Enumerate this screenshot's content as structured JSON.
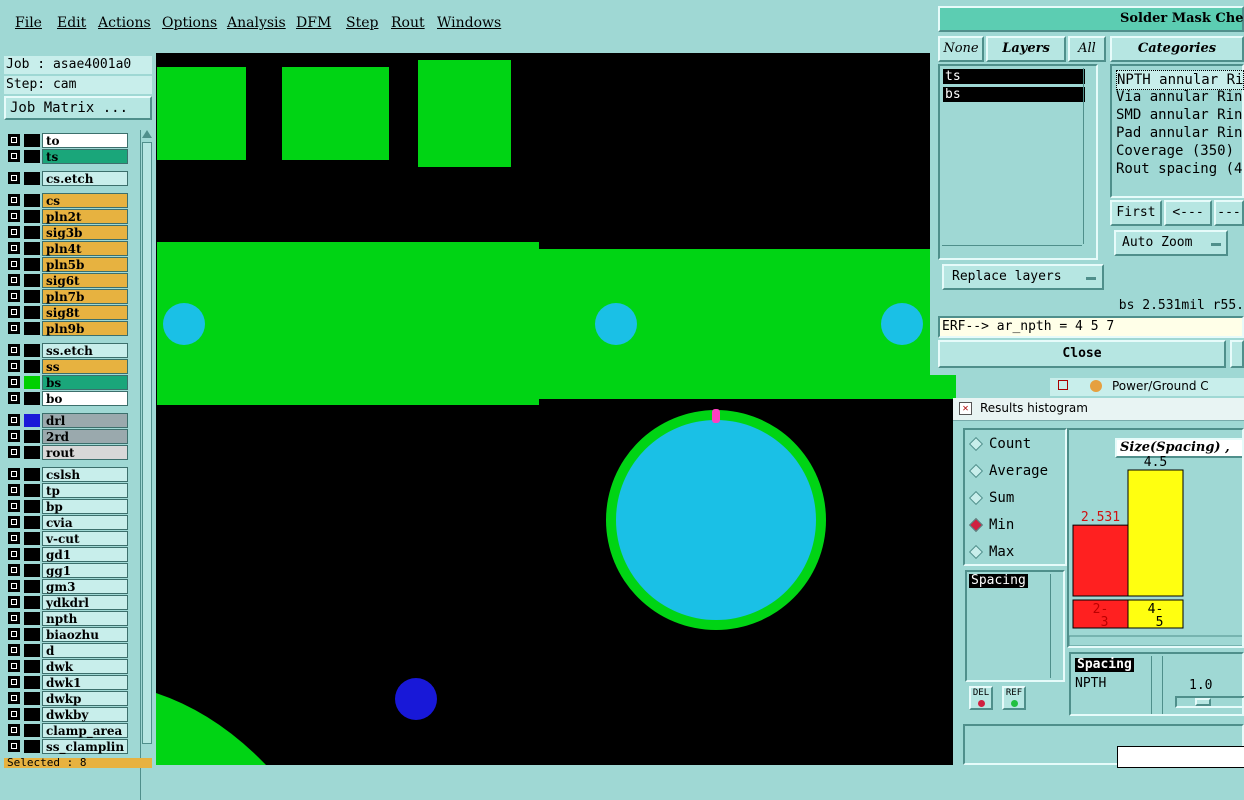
{
  "menubar": {
    "items": [
      "File",
      "Edit",
      "Actions",
      "Options",
      "Analysis",
      "DFM",
      "Step",
      "Rout",
      "Windows"
    ]
  },
  "job": {
    "job_line": "Job : asae4001a0",
    "step_line": "Step: cam",
    "matrix_button": "Job Matrix ...",
    "selected": "Selected : 8"
  },
  "layers": [
    {
      "name": "to",
      "color": "#ffffff",
      "swatch": "#000000",
      "mark": "✐"
    },
    {
      "name": "ts",
      "color": "#1aa67a",
      "swatch": "#000000",
      "mark": "✐"
    },
    {
      "name": "cs.etch",
      "color": "#c8eeeb",
      "swatch": "#000000",
      "mark": ""
    },
    {
      "name": "cs",
      "color": "#e7b240",
      "swatch": "#000000",
      "mark": "✐"
    },
    {
      "name": "pln2t",
      "color": "#e7b240",
      "swatch": "#000000",
      "mark": "✐"
    },
    {
      "name": "sig3b",
      "color": "#e7b240",
      "swatch": "#000000",
      "mark": "✐"
    },
    {
      "name": "pln4t",
      "color": "#e7b240",
      "swatch": "#000000",
      "mark": "✐"
    },
    {
      "name": "pln5b",
      "color": "#e7b240",
      "swatch": "#000000",
      "mark": "✐"
    },
    {
      "name": "sig6t",
      "color": "#e7b240",
      "swatch": "#000000",
      "mark": "✐"
    },
    {
      "name": "pln7b",
      "color": "#e7b240",
      "swatch": "#000000",
      "mark": "✐"
    },
    {
      "name": "sig8t",
      "color": "#e7b240",
      "swatch": "#000000",
      "mark": "✐"
    },
    {
      "name": "pln9b",
      "color": "#e7b240",
      "swatch": "#000000",
      "mark": "✐"
    },
    {
      "name": "ss.etch",
      "color": "#c8eeeb",
      "swatch": "#000000",
      "mark": ""
    },
    {
      "name": "ss",
      "color": "#e7b240",
      "swatch": "#000000",
      "mark": "✐"
    },
    {
      "name": "bs",
      "color": "#1aa67a",
      "swatch": "#00d000",
      "mark": "✐"
    },
    {
      "name": "bo",
      "color": "#ffffff",
      "swatch": "#000000",
      "mark": "✐"
    },
    {
      "name": "drl",
      "color": "#9aa9ad",
      "swatch": "#1a1ad8",
      "mark": "▦"
    },
    {
      "name": "2rd",
      "color": "#9aa9ad",
      "swatch": "#000000",
      "mark": ""
    },
    {
      "name": "rout",
      "color": "#d8d8d8",
      "swatch": "#000000",
      "mark": ""
    },
    {
      "name": "cslsh",
      "color": "#c8eeeb",
      "swatch": "#000000",
      "mark": ""
    },
    {
      "name": "tp",
      "color": "#c8eeeb",
      "swatch": "#000000",
      "mark": "✐"
    },
    {
      "name": "bp",
      "color": "#c8eeeb",
      "swatch": "#000000",
      "mark": "✐"
    },
    {
      "name": "cvia",
      "color": "#c8eeeb",
      "swatch": "#000000",
      "mark": ""
    },
    {
      "name": "v-cut",
      "color": "#c8eeeb",
      "swatch": "#000000",
      "mark": ""
    },
    {
      "name": "gd1",
      "color": "#c8eeeb",
      "swatch": "#000000",
      "mark": "✐"
    },
    {
      "name": "gg1",
      "color": "#c8eeeb",
      "swatch": "#000000",
      "mark": "✐"
    },
    {
      "name": "gm3",
      "color": "#c8eeeb",
      "swatch": "#000000",
      "mark": "✐"
    },
    {
      "name": "ydkdrl",
      "color": "#c8eeeb",
      "swatch": "#000000",
      "mark": ""
    },
    {
      "name": "npth",
      "color": "#c8eeeb",
      "swatch": "#000000",
      "mark": ""
    },
    {
      "name": "biaozhu",
      "color": "#c8eeeb",
      "swatch": "#000000",
      "mark": ""
    },
    {
      "name": "d",
      "color": "#c8eeeb",
      "swatch": "#000000",
      "mark": ""
    },
    {
      "name": "dwk",
      "color": "#c8eeeb",
      "swatch": "#000000",
      "mark": ""
    },
    {
      "name": "dwk1",
      "color": "#c8eeeb",
      "swatch": "#000000",
      "mark": ""
    },
    {
      "name": "dwkp",
      "color": "#c8eeeb",
      "swatch": "#000000",
      "mark": ""
    },
    {
      "name": "dwkby",
      "color": "#c8eeeb",
      "swatch": "#000000",
      "mark": ""
    },
    {
      "name": "clamp_area",
      "color": "#c8eeeb",
      "swatch": "#000000",
      "mark": ""
    },
    {
      "name": "ss_clamplin",
      "color": "#c8eeeb",
      "swatch": "#000000",
      "mark": ""
    }
  ],
  "smc": {
    "title": "Solder Mask Check",
    "none_btn": "None",
    "layers_btn": "Layers",
    "all_btn": "All",
    "categories_label": "Categories",
    "layer_items": [
      "ts",
      "bs"
    ],
    "categories": [
      "NPTH annular Ri",
      "Via annular Rin",
      "SMD annular Rin",
      "Pad annular Rin",
      "Coverage (350)",
      "Rout spacing (4"
    ],
    "first_btn": "First",
    "prev_btn": "<---",
    "next_btn": "---",
    "autozoom": "Auto Zoom",
    "replace": "Replace layers",
    "status": "bs 2.531mil  r55.",
    "erf": "ERF--> ar_npth = 4 5 7",
    "close": "Close",
    "behind_text": "Power/Ground C"
  },
  "hist": {
    "title": "Results histogram",
    "radios": [
      {
        "label": "Count",
        "on": false
      },
      {
        "label": "Average",
        "on": false
      },
      {
        "label": "Sum",
        "on": false
      },
      {
        "label": "Min",
        "on": true
      },
      {
        "label": "Max",
        "on": false
      }
    ],
    "list_item": "Spacing",
    "del": "DEL",
    "ref": "REF",
    "info1": "Spacing",
    "info2": "NPTH",
    "scale_val": "1.0",
    "chart_title": "Size(Spacing) ,",
    "bars": [
      {
        "value_label": "2.531",
        "bin_label": "2-\n3",
        "color": "#ff2020"
      },
      {
        "value_label": "4.5",
        "bin_label": "4-\n5",
        "color": "#ffff10"
      }
    ]
  },
  "chart_data": {
    "type": "bar",
    "title": "Size(Spacing) ,",
    "categories": [
      "2-3",
      "4-5"
    ],
    "values": [
      2.531,
      4.5
    ],
    "colors": [
      "#ff2020",
      "#ffff10"
    ]
  }
}
